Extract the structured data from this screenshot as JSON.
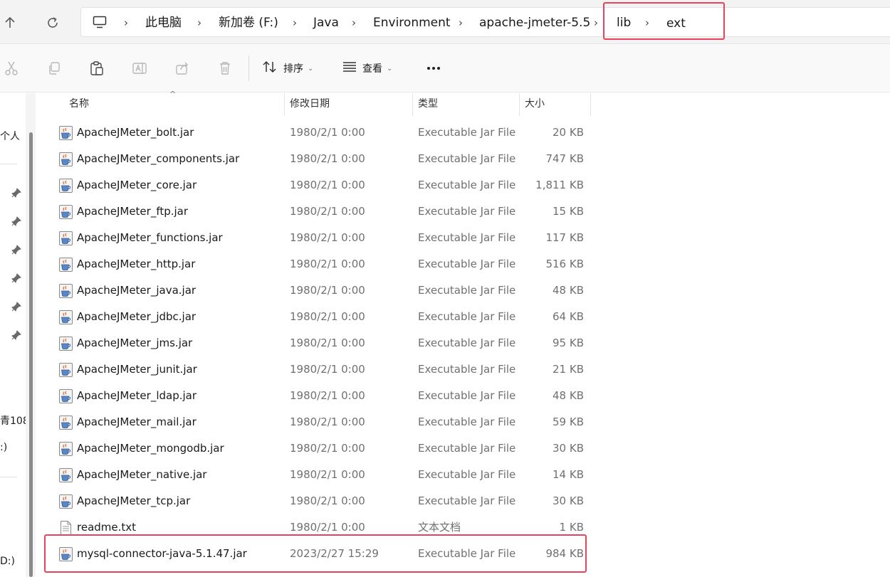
{
  "address_bar": {
    "breadcrumbs": [
      "此电脑",
      "新加卷 (F:)",
      "Java",
      "Environment",
      "apache-jmeter-5.5",
      "lib",
      "ext"
    ]
  },
  "toolbar": {
    "sort_label": "排序",
    "view_label": "查看",
    "icons": [
      "cut-icon",
      "copy-icon",
      "paste-icon",
      "rename-icon",
      "share-icon",
      "delete-icon",
      "sort-icon",
      "view-icon",
      "more-icon"
    ]
  },
  "nav_pane": {
    "items": [
      "个人",
      "青108",
      ":)",
      "D:)"
    ]
  },
  "columns": {
    "name": "名称",
    "date": "修改日期",
    "type": "类型",
    "size": "大小"
  },
  "files": [
    {
      "name": "ApacheJMeter_bolt.jar",
      "date": "1980/2/1 0:00",
      "type": "Executable Jar File",
      "size": "20 KB",
      "icon": "jar-file-icon"
    },
    {
      "name": "ApacheJMeter_components.jar",
      "date": "1980/2/1 0:00",
      "type": "Executable Jar File",
      "size": "747 KB",
      "icon": "jar-file-icon"
    },
    {
      "name": "ApacheJMeter_core.jar",
      "date": "1980/2/1 0:00",
      "type": "Executable Jar File",
      "size": "1,811 KB",
      "icon": "jar-file-icon"
    },
    {
      "name": "ApacheJMeter_ftp.jar",
      "date": "1980/2/1 0:00",
      "type": "Executable Jar File",
      "size": "15 KB",
      "icon": "jar-file-icon"
    },
    {
      "name": "ApacheJMeter_functions.jar",
      "date": "1980/2/1 0:00",
      "type": "Executable Jar File",
      "size": "117 KB",
      "icon": "jar-file-icon"
    },
    {
      "name": "ApacheJMeter_http.jar",
      "date": "1980/2/1 0:00",
      "type": "Executable Jar File",
      "size": "516 KB",
      "icon": "jar-file-icon"
    },
    {
      "name": "ApacheJMeter_java.jar",
      "date": "1980/2/1 0:00",
      "type": "Executable Jar File",
      "size": "48 KB",
      "icon": "jar-file-icon"
    },
    {
      "name": "ApacheJMeter_jdbc.jar",
      "date": "1980/2/1 0:00",
      "type": "Executable Jar File",
      "size": "64 KB",
      "icon": "jar-file-icon"
    },
    {
      "name": "ApacheJMeter_jms.jar",
      "date": "1980/2/1 0:00",
      "type": "Executable Jar File",
      "size": "95 KB",
      "icon": "jar-file-icon"
    },
    {
      "name": "ApacheJMeter_junit.jar",
      "date": "1980/2/1 0:00",
      "type": "Executable Jar File",
      "size": "21 KB",
      "icon": "jar-file-icon"
    },
    {
      "name": "ApacheJMeter_ldap.jar",
      "date": "1980/2/1 0:00",
      "type": "Executable Jar File",
      "size": "48 KB",
      "icon": "jar-file-icon"
    },
    {
      "name": "ApacheJMeter_mail.jar",
      "date": "1980/2/1 0:00",
      "type": "Executable Jar File",
      "size": "59 KB",
      "icon": "jar-file-icon"
    },
    {
      "name": "ApacheJMeter_mongodb.jar",
      "date": "1980/2/1 0:00",
      "type": "Executable Jar File",
      "size": "30 KB",
      "icon": "jar-file-icon"
    },
    {
      "name": "ApacheJMeter_native.jar",
      "date": "1980/2/1 0:00",
      "type": "Executable Jar File",
      "size": "14 KB",
      "icon": "jar-file-icon"
    },
    {
      "name": "ApacheJMeter_tcp.jar",
      "date": "1980/2/1 0:00",
      "type": "Executable Jar File",
      "size": "30 KB",
      "icon": "jar-file-icon"
    },
    {
      "name": "readme.txt",
      "date": "1980/2/1 0:00",
      "type": "文本文档",
      "size": "1 KB",
      "icon": "text-file-icon"
    },
    {
      "name": "mysql-connector-java-5.1.47.jar",
      "date": "2023/2/27 15:29",
      "type": "Executable Jar File",
      "size": "984 KB",
      "icon": "jar-file-icon"
    }
  ],
  "colors": {
    "highlight": "#e8435a",
    "secondary_text": "#707070"
  }
}
